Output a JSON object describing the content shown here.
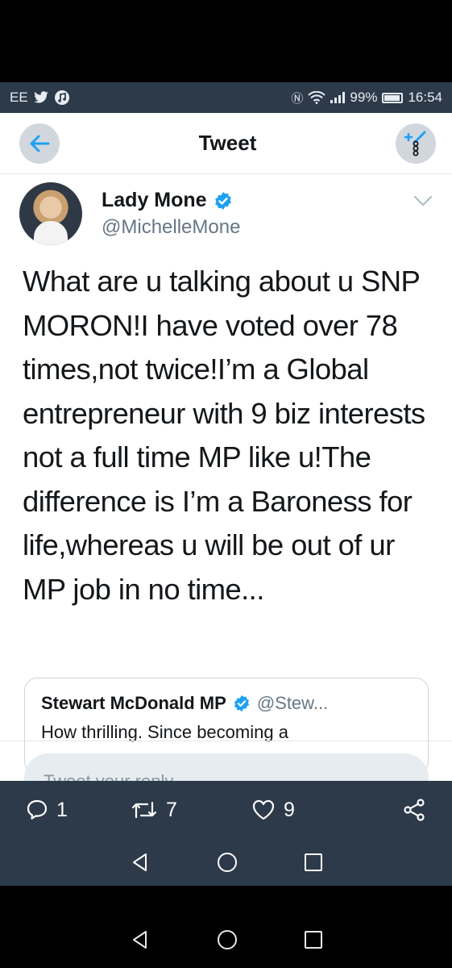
{
  "status": {
    "carrier": "EE",
    "battery": "99%",
    "time": "16:54"
  },
  "header": {
    "title": "Tweet"
  },
  "tweet": {
    "display_name": "Lady Mone",
    "handle": "@MichelleMone",
    "text": "What are u talking about u SNP MORON!I have voted over 78 times,not twice!I’m a Global entrepreneur with 9 biz interests not a full time MP like u!The difference is I’m a Baroness for life,whereas u will be out of ur MP job in no time...",
    "quote": {
      "name": "Stewart McDonald MP",
      "handle": "@Stew...",
      "text_partial": "How thrilling. Since becoming a"
    }
  },
  "reply": {
    "placeholder": "Tweet your reply"
  },
  "actions": {
    "replies": "1",
    "retweets": "7",
    "likes": "9"
  },
  "colors": {
    "bar": "#2c3a4a",
    "verified": "#1da1f2",
    "text": "#14171a",
    "muted": "#657786"
  },
  "icons": [
    "back-arrow-icon",
    "edit-add-icon",
    "verified-badge-icon",
    "chevron-down-icon",
    "reply-icon",
    "retweet-icon",
    "heart-icon",
    "share-icon",
    "nav-back-icon",
    "nav-home-icon",
    "nav-recents-icon"
  ]
}
